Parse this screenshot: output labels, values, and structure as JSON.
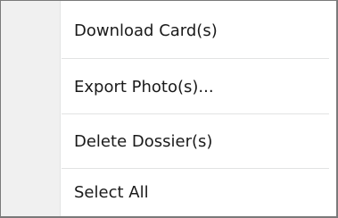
{
  "context_menu": {
    "items": [
      {
        "label": "Download Card(s)"
      },
      {
        "label": "Export Photo(s)..."
      },
      {
        "label": "Delete Dossier(s)"
      },
      {
        "label": "Select All"
      }
    ]
  },
  "colors": {
    "gutter": "#f0f0f0",
    "border": "#7a7a7a",
    "separator": "#e2e3e3",
    "text": "#1a1a1a"
  }
}
